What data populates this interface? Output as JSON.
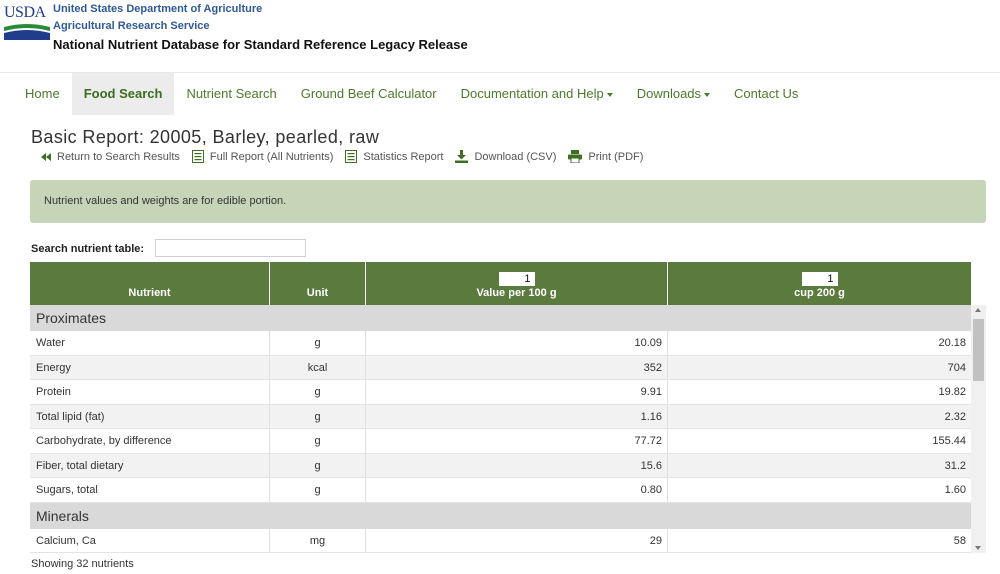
{
  "header": {
    "logo_text": "USDA",
    "agency_line1": "United States Department of Agriculture",
    "agency_line2": "Agricultural Research Service",
    "db_title": "National Nutrient Database for Standard Reference Legacy Release"
  },
  "nav": {
    "items": [
      {
        "label": "Home"
      },
      {
        "label": "Food Search",
        "active": true
      },
      {
        "label": "Nutrient Search"
      },
      {
        "label": "Ground Beef Calculator"
      },
      {
        "label": "Documentation and Help",
        "dropdown": true
      },
      {
        "label": "Downloads",
        "dropdown": true
      },
      {
        "label": "Contact Us"
      }
    ]
  },
  "report": {
    "title": "Basic Report:  20005, Barley, pearled, raw",
    "links": {
      "return": "Return to Search Results",
      "full": "Full Report (All Nutrients)",
      "stats": "Statistics Report",
      "csv": "Download (CSV)",
      "pdf": "Print (PDF)"
    },
    "icons": {
      "return": "double-chevron-left-icon",
      "full": "document-icon",
      "stats": "document-icon",
      "csv": "download-icon",
      "pdf": "printer-icon"
    }
  },
  "notice": "Nutrient values and weights are for edible portion.",
  "search": {
    "label": "Search nutrient table:",
    "value": ""
  },
  "table": {
    "headers": {
      "nutrient": "Nutrient",
      "unit": "Unit",
      "col3_qty": "1",
      "col3": "Value per 100 g",
      "col4_qty": "1",
      "col4": "cup 200 g"
    },
    "groups": [
      {
        "name": "Proximates",
        "rows": [
          {
            "nutrient": "Water",
            "unit": "g",
            "per100": "10.09",
            "cup": "20.18"
          },
          {
            "nutrient": "Energy",
            "unit": "kcal",
            "per100": "352",
            "cup": "704"
          },
          {
            "nutrient": "Protein",
            "unit": "g",
            "per100": "9.91",
            "cup": "19.82"
          },
          {
            "nutrient": "Total lipid (fat)",
            "unit": "g",
            "per100": "1.16",
            "cup": "2.32"
          },
          {
            "nutrient": "Carbohydrate, by difference",
            "unit": "g",
            "per100": "77.72",
            "cup": "155.44"
          },
          {
            "nutrient": "Fiber, total dietary",
            "unit": "g",
            "per100": "15.6",
            "cup": "31.2"
          },
          {
            "nutrient": "Sugars, total",
            "unit": "g",
            "per100": "0.80",
            "cup": "1.60"
          }
        ]
      },
      {
        "name": "Minerals",
        "rows": [
          {
            "nutrient": "Calcium, Ca",
            "unit": "mg",
            "per100": "29",
            "cup": "58"
          }
        ]
      }
    ]
  },
  "footer": "Showing 32 nutrients",
  "colors": {
    "header_green": "#5a7a3e",
    "nav_green": "#4b7a2b",
    "notice_bg": "#c6d5b8",
    "usda_blue": "#1e3c8a"
  }
}
